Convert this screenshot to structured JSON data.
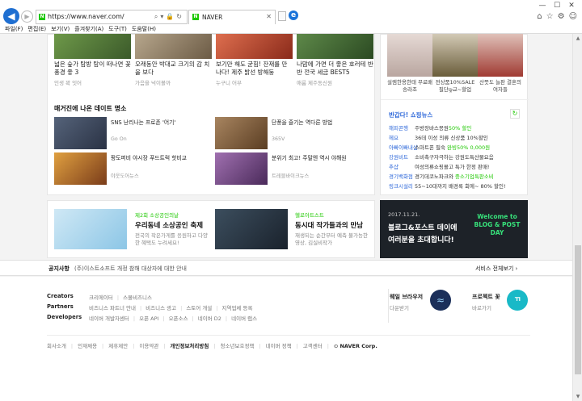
{
  "browser": {
    "url": "https://www.naver.com/",
    "tab_title": "NAVER",
    "favicon_letter": "N",
    "menu": [
      "파일(F)",
      "편집(E)",
      "보기(V)",
      "즐겨찾기(A)",
      "도구(T)",
      "도움말(H)"
    ],
    "window_controls": [
      "—",
      "☐",
      "✕"
    ]
  },
  "cards": [
    {
      "title": "넓은 숲가 탐방 탐이 떠나면 꽃 풍경 좋 3",
      "source": "인생 꽉 잇어",
      "color": "#6f9a4a"
    },
    {
      "title": "오래동안 박대교 크기의 감 치을 보다",
      "source": "가음을 넉이볼까",
      "color": "#9b8a73"
    },
    {
      "title": "보기만 해도 굳힘! 잔재를 만나다! 제주 밝선 방해둥",
      "source": "누구니 어부",
      "color": "#c64a2c"
    },
    {
      "title": "나맘에 가면 더 좋은 호러테 반반 전국 세금 BEST5",
      "source": "애룸 제주동신원",
      "color": "#3f6d3a"
    }
  ],
  "magazine": {
    "title": "매거진에 나온 데이트 명소",
    "items": [
      {
        "title": "SNS 난리나는 프로존 '어기'",
        "source": "Go On",
        "color": "#41506a"
      },
      {
        "title": "단풍을 즐기는 역다른 방법",
        "source": "365V",
        "color": "#8a6a4a"
      },
      {
        "title": "팡도퍼비 야시장 푸드트럭 핫비교",
        "source": "야웃도어뉴스",
        "color": "#c98a2a"
      },
      {
        "title": "분위기 최고! 주말엔 역시 야해원",
        "source": "트레블바이크뉴스",
        "color": "#8b5a9a"
      }
    ]
  },
  "shopping": {
    "items": [
      {
        "label": "설렘한용한태 무료배송라조",
        "color": "#d9c8c4"
      },
      {
        "label": "전상품10%SALE 필단ꝙ교~할업",
        "color": "#8a7d5a"
      },
      {
        "label": "산뜻도 늘판 결혼의 여자들",
        "color": "#b74b45"
      }
    ],
    "news_title": "반갑다! 쇼핑뉴스",
    "news": [
      {
        "cat": "해피콘행",
        "text": "주방장바스몽원",
        "hl": "50% 할인"
      },
      {
        "cat": "헤요",
        "text": "36데 이성 의류 신상품 10%할인",
        "hl": ""
      },
      {
        "cat": "아빠이빠내샵",
        "text": "스마트폰 필숙 ",
        "hl": "완빙50% 0,000원"
      },
      {
        "cat": "강원비트",
        "text": "소비촉구자극하는 강원도특산물요음",
        "hl": ""
      },
      {
        "cat": "추샵",
        "text": "여성의류쇼핑몰고 특가 한정 판매!",
        "hl": ""
      },
      {
        "cat": "경기백화점",
        "text": "경기데코노파크와 ",
        "hl": "중소기업특판소비"
      },
      {
        "cat": "링크시설리",
        "text": "55~10대까지 배경록 회에~ 80% 할인!",
        "hl": ""
      }
    ],
    "refresh_icon": "refresh-icon"
  },
  "promos": [
    {
      "tag": "제2회 소상공인의날",
      "headline": "우리동네 소상공인 축제",
      "desc": "전국의 작은가게를 응원하고 다양한 혜택도 누려세요!",
      "color": "#bfe1f2"
    },
    {
      "tag": "헬로아트스트",
      "headline": "동시대 작가들과의 만남",
      "desc": "재생되는 순간부터 예측 불가능한 영상, 김실비작가",
      "color": "#2b3a48"
    }
  ],
  "banner": {
    "date": "2017.11.21.",
    "line1": "블로그&포스트 데이에",
    "line2": "여러분을 초대합니다!",
    "badge": "Welcome to BLOG & POST DAY"
  },
  "footer": {
    "notice_label": "공지사항",
    "notice_text": "(주)이스트소프트 개정 참해 대상자에 대한 안내",
    "service_all": "서비스 전체보기",
    "rows": [
      {
        "label": "Creators",
        "links": [
          "크리에이터",
          "스몰비즈니스"
        ]
      },
      {
        "label": "Partners",
        "links": [
          "비즈니스 파트너 안내",
          "비즈니스 광고",
          "스토어 개설",
          "지역업체 등록"
        ]
      },
      {
        "label": "Developers",
        "links": [
          "네이버 개발자센터",
          "오픈 API",
          "오픈소스",
          "네이버 D2",
          "네이버 랩스"
        ]
      }
    ],
    "whale": {
      "title": "웨일 브라우저",
      "sub": "다운받기"
    },
    "kkuk": {
      "title": "프로젝트 꽃",
      "sub": "바로가기"
    },
    "bottom_links": [
      "회사소개",
      "인재채용",
      "제휴제안",
      "이용약관",
      "개인정보처리방침",
      "청소년보호정책",
      "네이버 정책",
      "고객센터"
    ],
    "copyright": "NAVER Corp."
  }
}
